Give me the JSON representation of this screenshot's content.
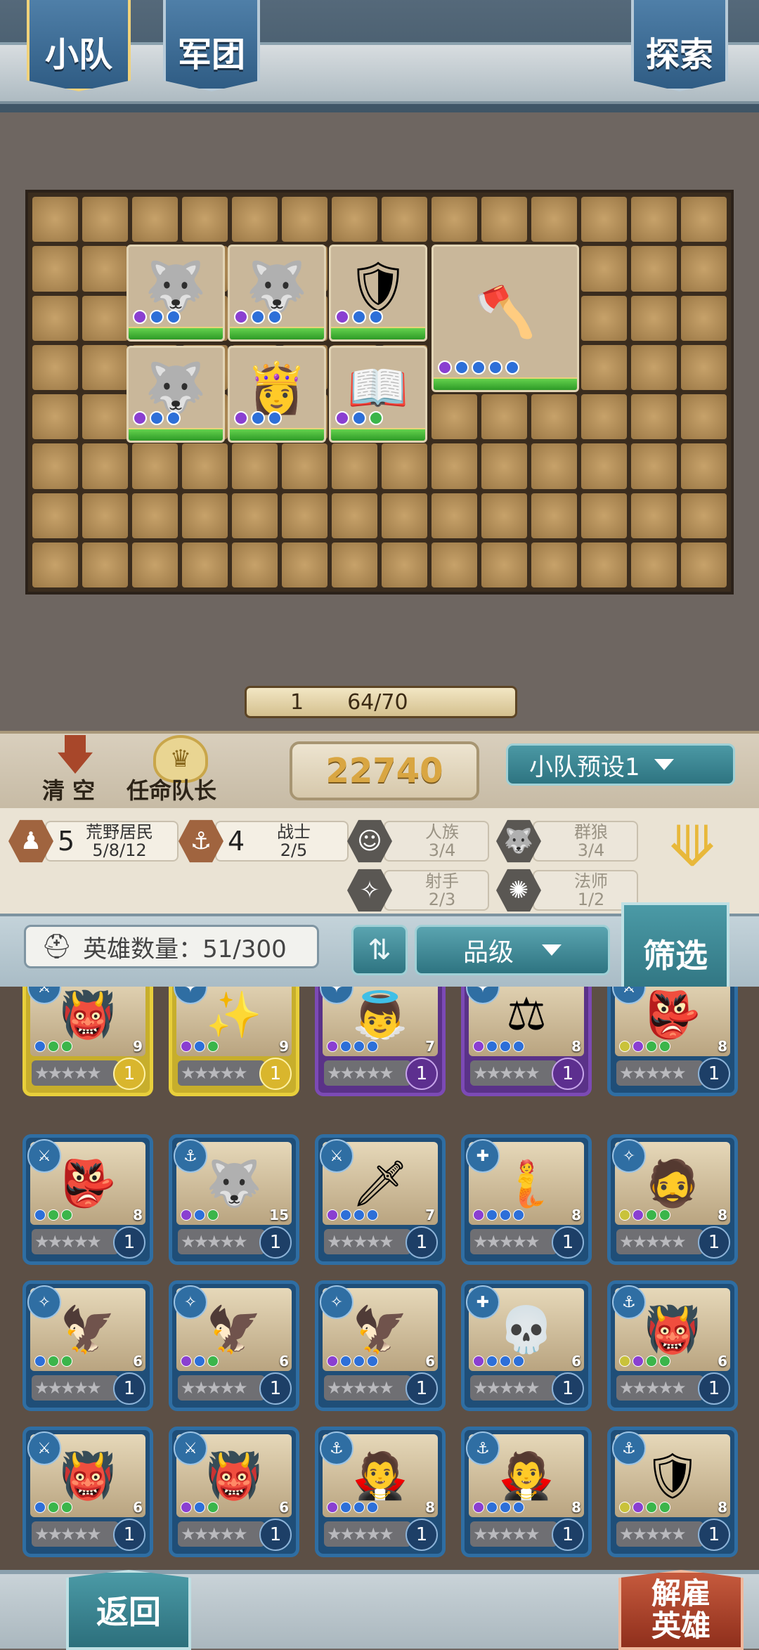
{
  "tabs": {
    "squad": "小队",
    "legion": "军团",
    "explore": "探索"
  },
  "capacity": {
    "level": "1",
    "value": "64/70"
  },
  "actions": {
    "clear": "清 空",
    "appoint_captain": "任命队长"
  },
  "power": "22740",
  "preset": {
    "label": "小队预设1"
  },
  "synergies": [
    {
      "icon": "wildlander-icon",
      "count": "5",
      "name": "荒野居民",
      "progress": "5/8/12",
      "active": true
    },
    {
      "icon": "warrior-icon",
      "count": "4",
      "name": "战士",
      "progress": "2/5",
      "active": true
    },
    {
      "icon": "human-icon",
      "count": "",
      "name": "人族",
      "progress": "3/4",
      "active": false
    },
    {
      "icon": "wolfpack-icon",
      "count": "",
      "name": "群狼",
      "progress": "3/4",
      "active": false
    },
    {
      "icon": "archer-icon",
      "count": "",
      "name": "射手",
      "progress": "2/3",
      "active": false
    },
    {
      "icon": "mage-icon",
      "count": "",
      "name": "法师",
      "progress": "1/2",
      "active": false
    }
  ],
  "hero_count": {
    "label": "英雄数量：",
    "value": "51/300"
  },
  "sort": {
    "grade_label": "品级"
  },
  "filter_label": "筛选",
  "bottom": {
    "back": "返回",
    "dismiss_line1": "解雇",
    "dismiss_line2": "英雄"
  },
  "board_units": [
    {
      "name": "wolf",
      "icon": "🐺"
    },
    {
      "name": "wolf",
      "icon": "🐺"
    },
    {
      "name": "knight",
      "icon": "🛡"
    },
    {
      "name": "dwarf-warrior",
      "icon": "🪓"
    },
    {
      "name": "wolf",
      "icon": "🐺"
    },
    {
      "name": "nun",
      "icon": "👸"
    },
    {
      "name": "monk",
      "icon": "📖"
    }
  ],
  "heroes": [
    {
      "rarity": "gold",
      "icon": "👹",
      "level": "9",
      "rank": "1",
      "class": "⚔"
    },
    {
      "rarity": "gold",
      "icon": "✨",
      "level": "9",
      "rank": "1",
      "class": "✦"
    },
    {
      "rarity": "purple",
      "icon": "👼",
      "level": "7",
      "rank": "1",
      "class": "✦"
    },
    {
      "rarity": "purple",
      "icon": "⚖",
      "level": "8",
      "rank": "1",
      "class": "✦"
    },
    {
      "rarity": "blue",
      "icon": "👺",
      "level": "8",
      "rank": "1",
      "class": "⚔"
    },
    {
      "rarity": "blue",
      "icon": "👺",
      "level": "8",
      "rank": "1",
      "class": "⚔"
    },
    {
      "rarity": "blue",
      "icon": "🐺",
      "level": "15",
      "rank": "1",
      "class": "⚓"
    },
    {
      "rarity": "blue",
      "icon": "🗡",
      "level": "7",
      "rank": "1",
      "class": "⚔"
    },
    {
      "rarity": "blue",
      "icon": "🧜",
      "level": "8",
      "rank": "1",
      "class": "✚"
    },
    {
      "rarity": "blue",
      "icon": "🧔",
      "level": "8",
      "rank": "1",
      "class": "✧"
    },
    {
      "rarity": "blue",
      "icon": "🦅",
      "level": "6",
      "rank": "1",
      "class": "✧"
    },
    {
      "rarity": "blue",
      "icon": "🦅",
      "level": "6",
      "rank": "1",
      "class": "✧"
    },
    {
      "rarity": "blue",
      "icon": "🦅",
      "level": "6",
      "rank": "1",
      "class": "✧"
    },
    {
      "rarity": "blue",
      "icon": "💀",
      "level": "6",
      "rank": "1",
      "class": "✚"
    },
    {
      "rarity": "blue",
      "icon": "👹",
      "level": "6",
      "rank": "1",
      "class": "⚓"
    },
    {
      "rarity": "blue",
      "icon": "👹",
      "level": "6",
      "rank": "1",
      "class": "⚔"
    },
    {
      "rarity": "blue",
      "icon": "👹",
      "level": "6",
      "rank": "1",
      "class": "⚔"
    },
    {
      "rarity": "blue",
      "icon": "🧛",
      "level": "8",
      "rank": "1",
      "class": "⚓"
    },
    {
      "rarity": "blue",
      "icon": "🧛",
      "level": "8",
      "rank": "1",
      "class": "⚓"
    },
    {
      "rarity": "blue",
      "icon": "🛡",
      "level": "8",
      "rank": "1",
      "class": "⚓"
    }
  ],
  "stars": "★★★★★",
  "colors": {
    "accent": "#2e7481",
    "power": "#d9a642",
    "blue_card": "#2f6ea3",
    "gold_card": "#e8cf3b",
    "purple_card": "#7c4ab5"
  }
}
